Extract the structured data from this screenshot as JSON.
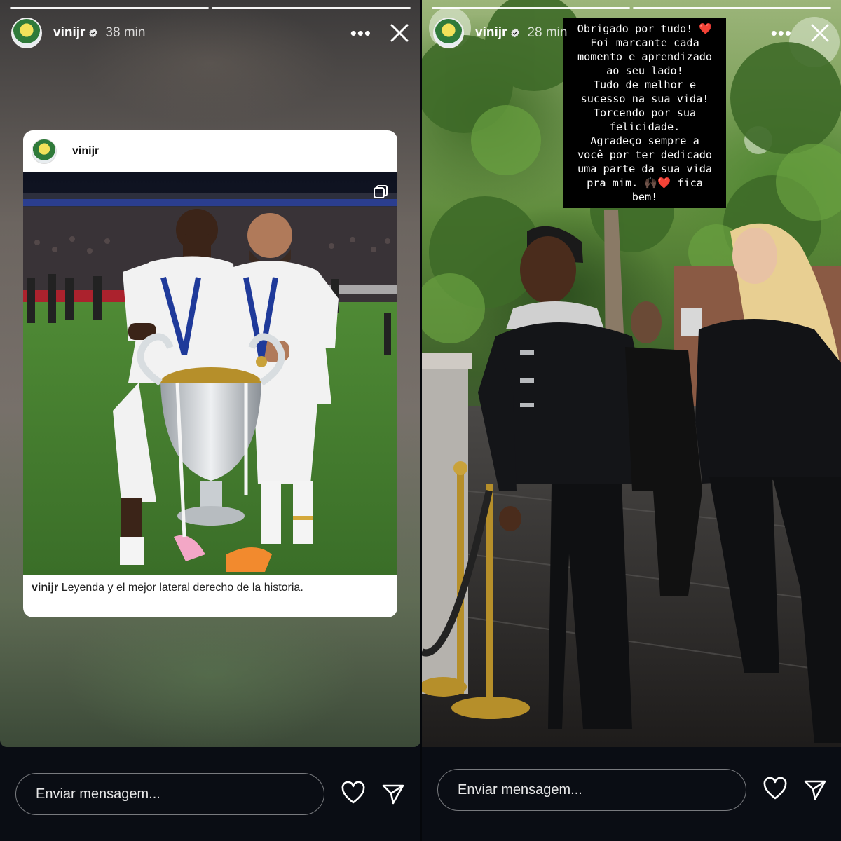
{
  "left_story": {
    "progress_segments": [
      1,
      1
    ],
    "header": {
      "username": "vinijr",
      "time": "38 min",
      "more_icon": "more-dots-icon",
      "close_icon": "close-icon"
    },
    "post": {
      "username": "vinijr",
      "caption_username": "vinijr",
      "caption_text": "Leyenda y el mejor lateral derecho de la historia.",
      "photo_description_icon": "multi-photo-icon"
    },
    "footer": {
      "message_placeholder": "Enviar mensagem...",
      "heart_icon": "heart-icon",
      "send_icon": "send-icon"
    }
  },
  "right_story": {
    "progress_segments": [
      1,
      1
    ],
    "header": {
      "username": "vinijr",
      "time": "28 min",
      "more_icon": "more-dots-icon",
      "close_icon": "close-icon"
    },
    "sticker_text": "Obrigado por tudo! ❤️\nFoi marcante cada\nmomento e aprendizado\nao seu lado!\nTudo de melhor e\nsucesso na sua vida!\nTorcendo por sua\nfelicidade.\nAgradeço sempre a\nvocê por ter dedicado\numa parte da sua vida\npra mim. 🙌🏿❤️ fica\nbem!",
    "footer": {
      "message_placeholder": "Enviar mensagem...",
      "heart_icon": "heart-icon",
      "send_icon": "send-icon"
    }
  },
  "colors": {
    "background": "#0a0d14",
    "card": "#ffffff",
    "verified": "#3897f0",
    "heart_sticker": "#e0245e"
  }
}
